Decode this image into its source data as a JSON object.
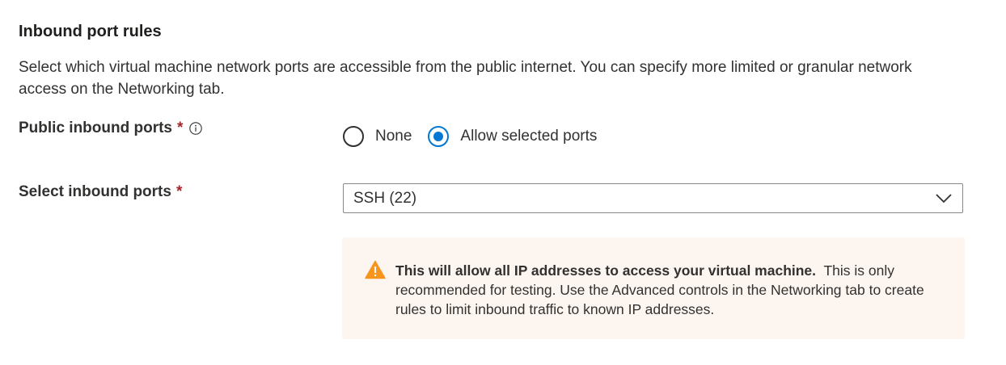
{
  "section": {
    "title": "Inbound port rules",
    "description": "Select which virtual machine network ports are accessible from the public internet. You can specify more limited or granular network access on the Networking tab."
  },
  "public_inbound_ports": {
    "label": "Public inbound ports",
    "required_mark": "*",
    "info_icon": "info-icon",
    "options": [
      {
        "label": "None",
        "selected": false
      },
      {
        "label": "Allow selected ports",
        "selected": true
      }
    ]
  },
  "select_inbound_ports": {
    "label": "Select inbound ports",
    "required_mark": "*",
    "value": "SSH (22)",
    "chevron_icon": "chevron-down-icon"
  },
  "warning": {
    "icon": "warning-icon",
    "bold_text": "This will allow all IP addresses to access your virtual machine.",
    "text": "This is only recommended for testing.  Use the Advanced controls in the Networking tab to create rules to limit inbound traffic to known IP addresses."
  },
  "colors": {
    "accent": "#0078d4",
    "required": "#a4262c",
    "warning_bg": "#fdf6f0",
    "warning_icon": "#f7941d"
  }
}
